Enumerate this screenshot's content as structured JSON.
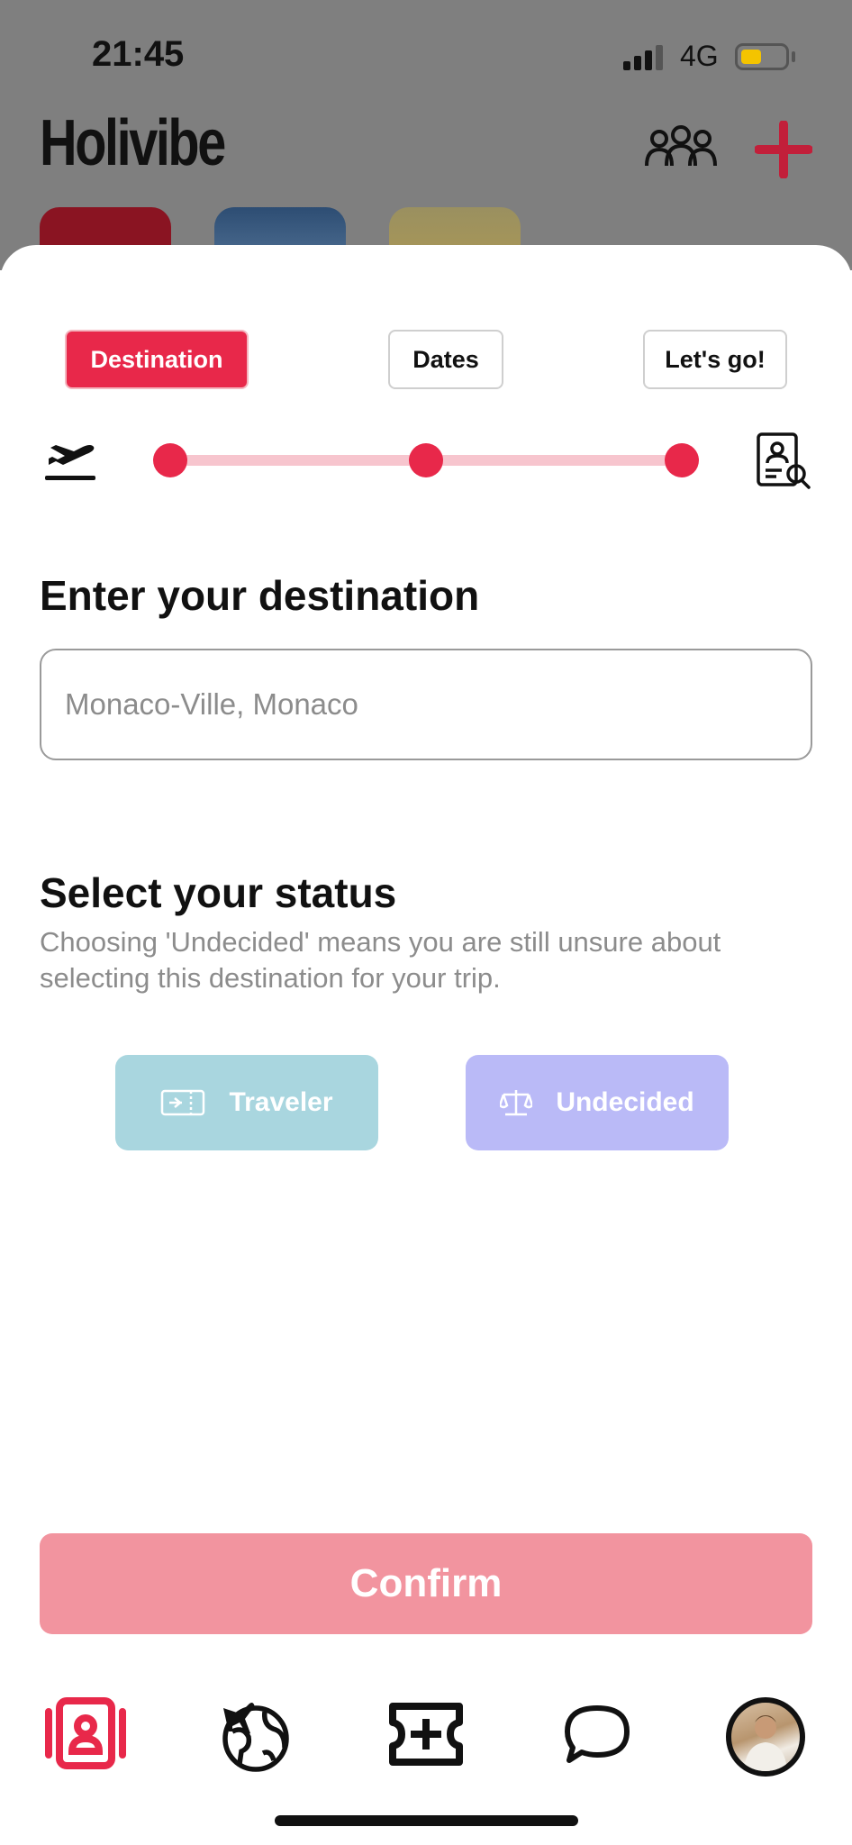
{
  "status_bar": {
    "time": "21:45",
    "network": "4G"
  },
  "app": {
    "title": "Holivibe"
  },
  "steps": [
    "Destination",
    "Dates",
    "Let's go!"
  ],
  "destination": {
    "heading": "Enter your destination",
    "placeholder": "Monaco-Ville, Monaco"
  },
  "status": {
    "heading": "Select your status",
    "description": "Choosing 'Undecided' means you are still unsure about selecting this destination for your trip.",
    "options": [
      "Traveler",
      "Undecided"
    ]
  },
  "confirm_label": "Confirm",
  "colors": {
    "accent": "#e8284a",
    "confirm": "#f2949f",
    "traveler": "#a9d6df",
    "undecided": "#babaf7",
    "brand_red": "#c21f3a"
  },
  "icons": [
    "people-group-icon",
    "plus-icon",
    "plane-takeoff-icon",
    "passport-icon",
    "ticket-icon",
    "scale-icon",
    "contacts-icon",
    "globe-plane-icon",
    "add-ticket-icon",
    "chat-bubble-icon",
    "avatar"
  ]
}
